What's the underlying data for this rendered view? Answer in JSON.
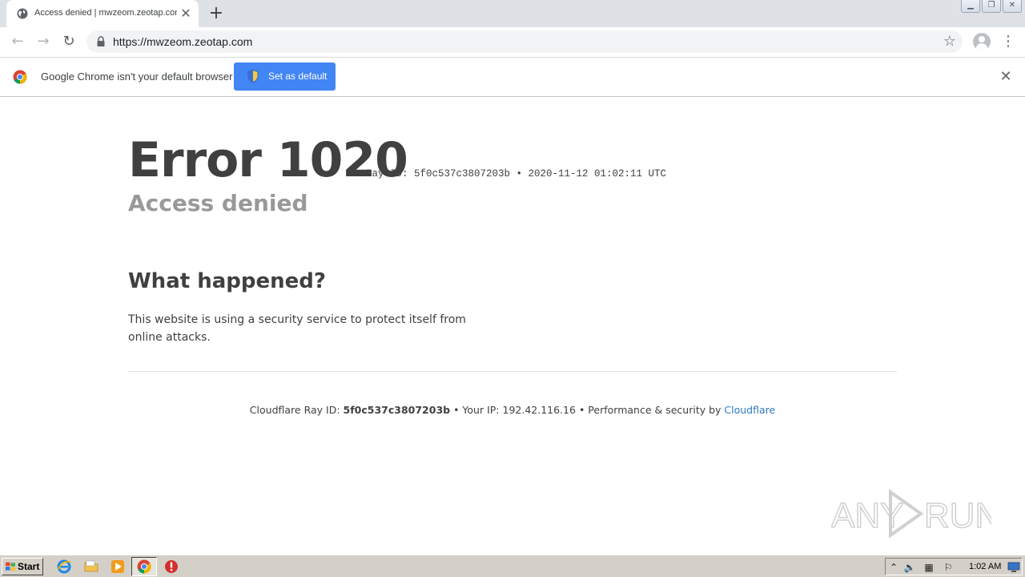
{
  "browser": {
    "tab": {
      "title": "Access denied | mwzeom.zeotap.com",
      "favicon": "globe-icon",
      "close": "close-icon"
    },
    "new_tab": "plus-icon",
    "window_controls": [
      "minimize-icon",
      "restore-icon",
      "close-icon"
    ],
    "toolbar": {
      "back": "back-arrow-icon",
      "forward": "forward-arrow-icon",
      "reload": "reload-icon",
      "url": "https://mwzeom.zeotap.com",
      "bookmark": "star-icon",
      "profile": "avatar-icon",
      "menu": "kebab-menu-icon"
    },
    "infobar": {
      "message": "Google Chrome isn't your default browser",
      "button_label": "Set as default",
      "close": "close-icon"
    }
  },
  "page": {
    "error_title": "Error 1020",
    "ray_line": "Ray ID: 5f0c537c3807203b • 2020-11-12 01:02:11 UTC",
    "subtitle": "Access denied",
    "section_heading": "What happened?",
    "explanation": "This website is using a security service to protect itself from online attacks.",
    "footer": {
      "ray_label": "Cloudflare Ray ID:",
      "ray_id": "5f0c537c3807203b",
      "ip_label": "• Your IP:",
      "ip": "192.42.116.16",
      "perf_label": "• Performance & security by",
      "cloudflare_link": "Cloudflare"
    }
  },
  "watermark": "ANY RUN",
  "taskbar": {
    "start_label": "Start",
    "clock": "1:02 AM",
    "pinned": [
      "ie-icon",
      "folder-icon",
      "media-player-icon",
      "chrome-icon",
      "stop-icon"
    ],
    "tray": [
      "expand-arrow-icon",
      "volume-icon",
      "network-icon",
      "flag-icon",
      "monitor-icon"
    ]
  },
  "colors": {
    "link": "#2f7bbf",
    "button_blue": "#4285f4",
    "text_dark": "#404040",
    "text_gray": "#999999"
  }
}
